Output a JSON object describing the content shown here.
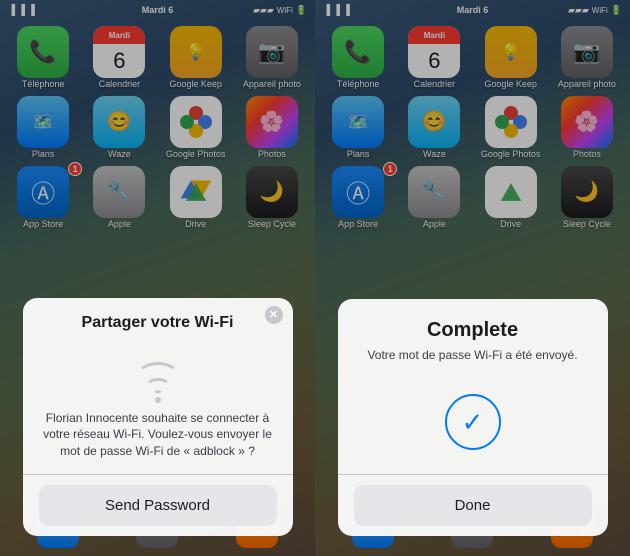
{
  "left_panel": {
    "status_time": "Mardi",
    "status_day": "6",
    "apps_row1": [
      {
        "label": "Téléphone",
        "icon": "phone",
        "badge": ""
      },
      {
        "label": "Calendrier",
        "icon": "calendar",
        "badge": ""
      },
      {
        "label": "Google Keep",
        "icon": "keep",
        "badge": ""
      },
      {
        "label": "Appareil photo",
        "icon": "camera",
        "badge": ""
      }
    ],
    "apps_row2": [
      {
        "label": "Plans",
        "icon": "plans",
        "badge": ""
      },
      {
        "label": "Waze",
        "icon": "waze",
        "badge": ""
      },
      {
        "label": "Google Photos",
        "icon": "gphotos",
        "badge": ""
      },
      {
        "label": "Photos",
        "icon": "photos",
        "badge": ""
      }
    ],
    "apps_row3": [
      {
        "label": "App Store",
        "icon": "appstore",
        "badge": "1"
      },
      {
        "label": "Apple",
        "icon": "apple",
        "badge": ""
      },
      {
        "label": "Drive",
        "icon": "drive",
        "badge": ""
      },
      {
        "label": "Sleep Cycle",
        "icon": "sleep",
        "badge": ""
      }
    ],
    "dialog": {
      "title": "Partager votre Wi-Fi",
      "body": "Florian Innocente souhaite se connecter à votre réseau Wi-Fi. Voulez-vous envoyer le mot de passe Wi-Fi de « adblock » ?",
      "button": "Send Password"
    }
  },
  "right_panel": {
    "status_time": "Mardi",
    "status_day": "6",
    "apps_row1": [
      {
        "label": "Téléphone",
        "icon": "phone",
        "badge": ""
      },
      {
        "label": "Calendrier",
        "icon": "calendar",
        "badge": ""
      },
      {
        "label": "Google Keep",
        "icon": "keep",
        "badge": ""
      },
      {
        "label": "Appareil photo",
        "icon": "camera",
        "badge": ""
      }
    ],
    "apps_row2": [
      {
        "label": "Plans",
        "icon": "plans",
        "badge": ""
      },
      {
        "label": "Waze",
        "icon": "waze",
        "badge": ""
      },
      {
        "label": "Google Photos",
        "icon": "gphotos",
        "badge": ""
      },
      {
        "label": "Photos",
        "icon": "photos",
        "badge": ""
      }
    ],
    "apps_row3": [
      {
        "label": "App Store",
        "icon": "appstore",
        "badge": "1"
      },
      {
        "label": "Apple",
        "icon": "apple",
        "badge": ""
      },
      {
        "label": "Drive",
        "icon": "drive",
        "badge": ""
      },
      {
        "label": "Sleep Cycle",
        "icon": "sleep",
        "badge": ""
      }
    ],
    "complete_dialog": {
      "title": "Complete",
      "subtitle": "Votre mot de passe Wi-Fi a été envoyé.",
      "done_button": "Done"
    }
  }
}
